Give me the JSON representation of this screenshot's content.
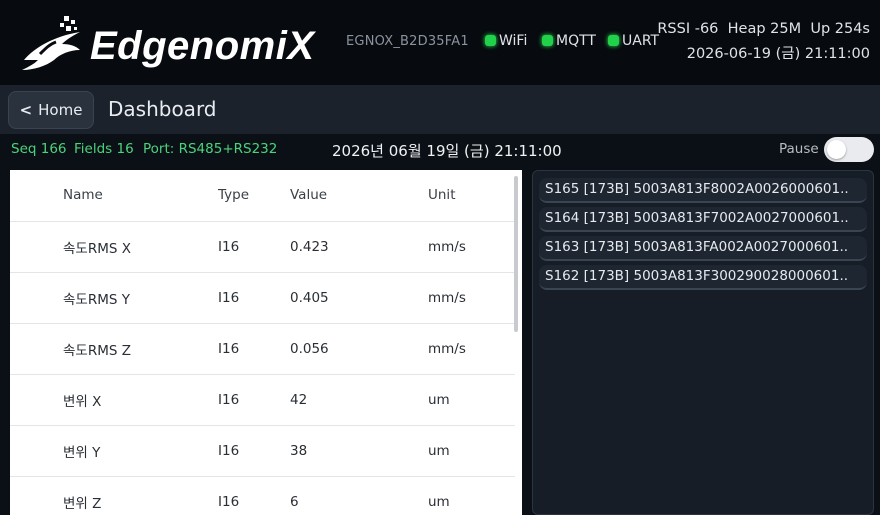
{
  "header": {
    "brand": "EdgenomiX",
    "device_id": "EGNOX_B2D35FA1",
    "connections": [
      {
        "label": "WiFi",
        "color": "#22d14a"
      },
      {
        "label": "MQTT",
        "color": "#22d14a"
      },
      {
        "label": "UART",
        "color": "#22d14a"
      }
    ],
    "stats": "RSSI -66  Heap 25M  Up 254s",
    "datetime": "2026-06-19 (금) 21:11:00"
  },
  "nav": {
    "home_label": "Home",
    "page_title": "Dashboard"
  },
  "status": {
    "seq": "Seq 166",
    "fields": "Fields 16",
    "port": "Port: RS485+RS232",
    "date_korean": "2026년 06월 19일 (금) 21:11:00",
    "pause_label": "Pause",
    "pause_on": false
  },
  "table": {
    "columns": [
      "Name",
      "Type",
      "Value",
      "Unit"
    ],
    "rows": [
      {
        "name": "속도RMS X",
        "type": "I16",
        "value": "0.423",
        "unit": "mm/s"
      },
      {
        "name": "속도RMS Y",
        "type": "I16",
        "value": "0.405",
        "unit": "mm/s"
      },
      {
        "name": "속도RMS Z",
        "type": "I16",
        "value": "0.056",
        "unit": "mm/s"
      },
      {
        "name": "변위 X",
        "type": "I16",
        "value": "42",
        "unit": "um"
      },
      {
        "name": "변위 Y",
        "type": "I16",
        "value": "38",
        "unit": "um"
      },
      {
        "name": "변위 Z",
        "type": "I16",
        "value": "6",
        "unit": "um"
      }
    ]
  },
  "log": {
    "items": [
      "S165 [173B] 5003A813F8002A0026000601..",
      "S164 [173B] 5003A813F7002A0027000601..",
      "S163 [173B] 5003A813FA002A0027000601..",
      "S162 [173B] 5003A813F300290028000601.."
    ]
  },
  "colors": {
    "accent_green": "#4bd37b",
    "led_green": "#22d14a",
    "header_bg": "#070a0e",
    "nav_bg": "#1b222c"
  }
}
